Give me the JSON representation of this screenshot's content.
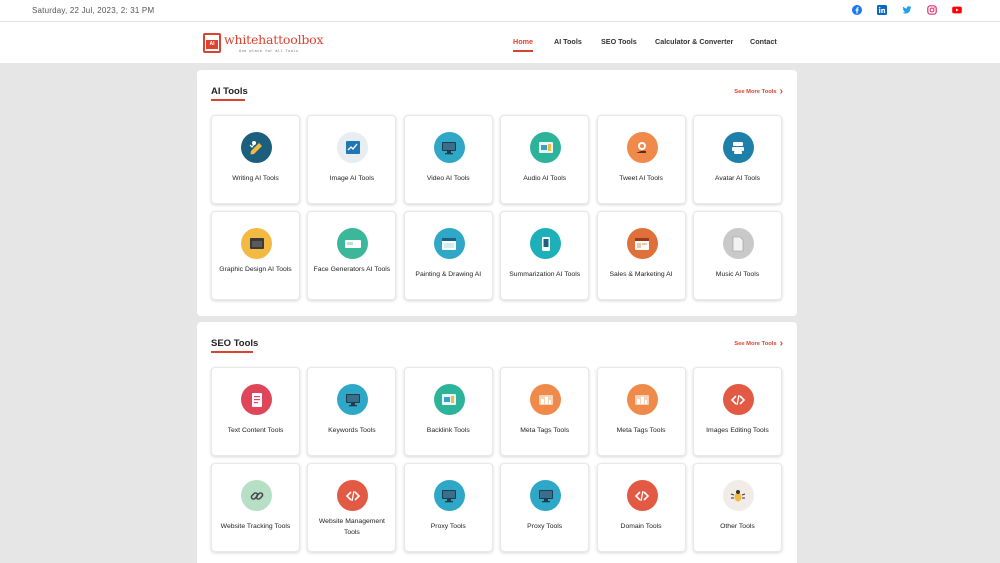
{
  "topbar": {
    "datetime": "Saturday, 22 Jul, 2023, 2: 31 PM",
    "socials": [
      {
        "icon": "facebook-icon",
        "color": "#1877f2"
      },
      {
        "icon": "linkedin-icon",
        "color": "#0a66c2"
      },
      {
        "icon": "twitter-icon",
        "color": "#1da1f2"
      },
      {
        "icon": "instagram-icon",
        "color": "#e1306c"
      },
      {
        "icon": "youtube-icon",
        "color": "#ff0000"
      }
    ]
  },
  "brand": {
    "name": "whitehattoolbox",
    "tagline": "One place for all Tools",
    "mark": "AI",
    "color": "#d9432f"
  },
  "nav": [
    {
      "label": "Home",
      "active": true
    },
    {
      "label": "AI Tools"
    },
    {
      "label": "SEO Tools"
    },
    {
      "label": "Calculator & Converter"
    },
    {
      "label": "Contact"
    }
  ],
  "ai_section": {
    "title": "AI Tools",
    "see_more": "See More Tools",
    "cards": [
      {
        "label": "Writing AI Tools",
        "icon": "writing-icon",
        "color": "#1b5f7d"
      },
      {
        "label": "Image AI Tools",
        "icon": "image-chart-icon",
        "color": "#e8edf2"
      },
      {
        "label": "Video AI Tools",
        "icon": "video-monitor-icon",
        "color": "#2fa8c8"
      },
      {
        "label": "Audio AI Tools",
        "icon": "audio-monitor-icon",
        "color": "#2eb39b"
      },
      {
        "label": "Tweet AI Tools",
        "icon": "tweet-hand-icon",
        "color": "#ef8a4a"
      },
      {
        "label": "Avatar AI Tools",
        "icon": "avatar-stack-icon",
        "color": "#1e7fa8"
      },
      {
        "label": "Graphic Design AI Tools",
        "icon": "graphic-design-icon",
        "color": "#f4b942"
      },
      {
        "label": "Face Generators AI Tools",
        "icon": "face-generator-icon",
        "color": "#3cb79a"
      },
      {
        "label": "Painting & Drawing AI",
        "icon": "painting-window-icon",
        "color": "#2fa8c8"
      },
      {
        "label": "Summarization AI Tools",
        "icon": "summarization-phone-icon",
        "color": "#1eb0b8"
      },
      {
        "label": "Sales & Marketing AI",
        "icon": "sales-window-icon",
        "color": "#e0703a"
      },
      {
        "label": "Music AI Tools",
        "icon": "music-doc-icon",
        "color": "#c9c9c9"
      }
    ]
  },
  "seo_section": {
    "title": "SEO Tools",
    "see_more": "See More Tools",
    "cards": [
      {
        "label": "Text Content Tools",
        "icon": "text-content-icon",
        "color": "#e0465a"
      },
      {
        "label": "Keywords Tools",
        "icon": "keywords-monitor-icon",
        "color": "#2fa8c8"
      },
      {
        "label": "Backlink Tools",
        "icon": "backlink-monitor-icon",
        "color": "#2eb39b"
      },
      {
        "label": "Meta Tags Tools",
        "icon": "meta-tags-icon",
        "color": "#ef8a4a"
      },
      {
        "label": "Meta Tags Tools",
        "icon": "meta-tags-icon",
        "color": "#ef8a4a"
      },
      {
        "label": "Images Editing Tools",
        "icon": "code-icon",
        "color": "#e25a43"
      },
      {
        "label": "Website Tracking Tools",
        "icon": "chain-link-icon",
        "color": "#b7dfc5"
      },
      {
        "label": "Website Management Tools",
        "icon": "code-icon",
        "color": "#e25a43"
      },
      {
        "label": "Proxy Tools",
        "icon": "proxy-monitor-icon",
        "color": "#2fa8c8"
      },
      {
        "label": "Proxy Tools",
        "icon": "proxy-monitor-icon",
        "color": "#2fa8c8"
      },
      {
        "label": "Domain Tools",
        "icon": "code-icon",
        "color": "#e25a43"
      },
      {
        "label": "Other Tools",
        "icon": "bug-icon",
        "color": "#f1ece8"
      }
    ]
  }
}
